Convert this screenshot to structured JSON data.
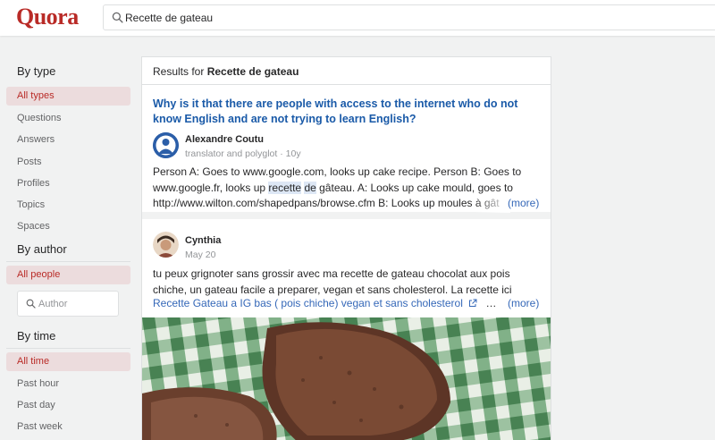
{
  "brand": "Quora",
  "search": {
    "query": "Recette de gateau"
  },
  "sidebar": {
    "by_type": {
      "title": "By type",
      "selected": "All types",
      "items": [
        "Questions",
        "Answers",
        "Posts",
        "Profiles",
        "Topics",
        "Spaces"
      ]
    },
    "by_author": {
      "title": "By author",
      "selected": "All people",
      "placeholder": "Author"
    },
    "by_time": {
      "title": "By time",
      "selected": "All time",
      "items": [
        "Past hour",
        "Past day",
        "Past week"
      ]
    }
  },
  "results": {
    "prefix": "Results for",
    "query": "Recette de gateau",
    "cards": [
      {
        "title": "Why is it that there are people with access to the internet who do not know English and are not trying to learn English?",
        "author": "Alexandre Coutu",
        "meta": "translator and polyglot · 10y",
        "excerpt_line1": "Person A: Goes to www.google.com, looks up cake recipe. Person B: Goes to",
        "excerpt_line2_pre": "www.google.fr, looks up ",
        "excerpt_line2_hl1": "recette",
        "excerpt_line2_mid": " ",
        "excerpt_line2_hl2": "de",
        "excerpt_line2_post": " gâteau. A: Looks up cake mould, goes to",
        "excerpt_line3": "http://www.wilton.com/shapedpans/browse.cfm B: Looks up moules à gât",
        "more": "(more)"
      },
      {
        "author": "Cynthia",
        "meta": "May 20",
        "excerpt_line1": "tu peux grignoter sans grossir avec ma recette de gateau chocolat aux pois",
        "excerpt_line2": "chiche, un gateau facile a preparer, vegan et sans cholesterol. La recette ici",
        "link": "Recette Gateau a IG bas ( pois chiche) vegan et sans cholesterol",
        "ellipsis": "…",
        "more": "(more)"
      }
    ]
  },
  "colors": {
    "brand": "#b92b27",
    "link": "#3568b8",
    "selected_bg": "#ecdcdd"
  },
  "icons": {
    "search": "search-icon",
    "author_search": "search-icon",
    "external": "external-link-icon"
  }
}
